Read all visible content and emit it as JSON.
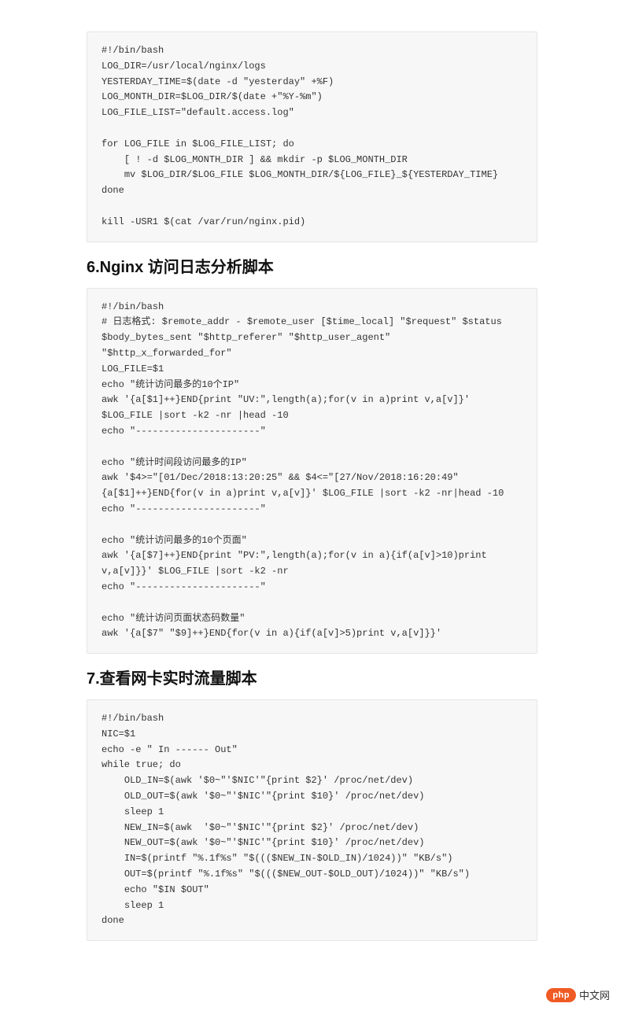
{
  "code_block_1": "#!/bin/bash\nLOG_DIR=/usr/local/nginx/logs\nYESTERDAY_TIME=$(date -d \"yesterday\" +%F)\nLOG_MONTH_DIR=$LOG_DIR/$(date +\"%Y-%m\")\nLOG_FILE_LIST=\"default.access.log\"\n\nfor LOG_FILE in $LOG_FILE_LIST; do\n    [ ! -d $LOG_MONTH_DIR ] && mkdir -p $LOG_MONTH_DIR\n    mv $LOG_DIR/$LOG_FILE $LOG_MONTH_DIR/${LOG_FILE}_${YESTERDAY_TIME}\ndone\n\nkill -USR1 $(cat /var/run/nginx.pid)",
  "heading_6": "6.Nginx 访问日志分析脚本",
  "code_block_2": "#!/bin/bash\n# 日志格式: $remote_addr - $remote_user [$time_local] \"$request\" $status $body_bytes_sent \"$http_referer\" \"$http_user_agent\" \"$http_x_forwarded_for\"\nLOG_FILE=$1\necho \"统计访问最多的10个IP\"\nawk '{a[$1]++}END{print \"UV:\",length(a);for(v in a)print v,a[v]}' $LOG_FILE |sort -k2 -nr |head -10\necho \"----------------------\"\n\necho \"统计时间段访问最多的IP\"\nawk '$4>=\"[01/Dec/2018:13:20:25\" && $4<=\"[27/Nov/2018:16:20:49\"{a[$1]++}END{for(v in a)print v,a[v]}' $LOG_FILE |sort -k2 -nr|head -10\necho \"----------------------\"\n\necho \"统计访问最多的10个页面\"\nawk '{a[$7]++}END{print \"PV:\",length(a);for(v in a){if(a[v]>10)print v,a[v]}}' $LOG_FILE |sort -k2 -nr\necho \"----------------------\"\n\necho \"统计访问页面状态码数量\"\nawk '{a[$7\" \"$9]++}END{for(v in a){if(a[v]>5)print v,a[v]}}'",
  "heading_7": "7.查看网卡实时流量脚本",
  "code_block_3": "#!/bin/bash\nNIC=$1\necho -e \" In ------ Out\"\nwhile true; do\n    OLD_IN=$(awk '$0~\"'$NIC'\"{print $2}' /proc/net/dev)\n    OLD_OUT=$(awk '$0~\"'$NIC'\"{print $10}' /proc/net/dev)\n    sleep 1\n    NEW_IN=$(awk  '$0~\"'$NIC'\"{print $2}' /proc/net/dev)\n    NEW_OUT=$(awk '$0~\"'$NIC'\"{print $10}' /proc/net/dev)\n    IN=$(printf \"%.1f%s\" \"$((($NEW_IN-$OLD_IN)/1024))\" \"KB/s\")\n    OUT=$(printf \"%.1f%s\" \"$((($NEW_OUT-$OLD_OUT)/1024))\" \"KB/s\")\n    echo \"$IN $OUT\"\n    sleep 1\ndone",
  "footer": {
    "logo_text": "php",
    "site_name": "中文网"
  }
}
